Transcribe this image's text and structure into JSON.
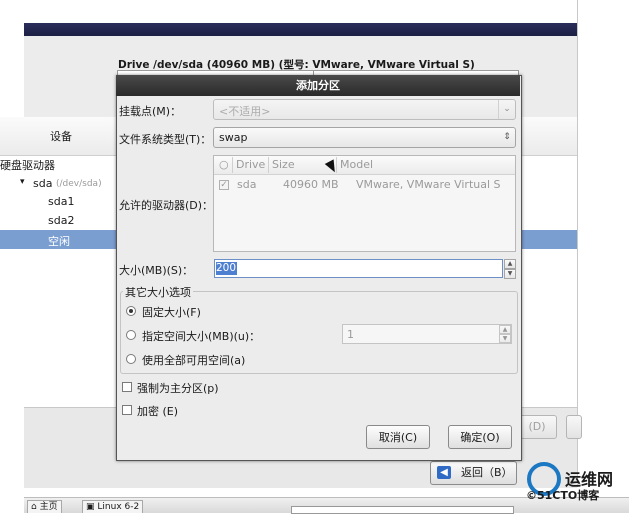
{
  "installer": {
    "drive_title": "Drive /dev/sda (40960 MB) (型号: VMware, VMware Virtual S)",
    "tree_header": "设备",
    "tree_items": [
      "硬盘驱动器",
      "sda",
      "(/dev/sda)",
      "sda1",
      "sda2",
      "空闲"
    ],
    "ghost_button": "(D)",
    "back_button": "返回（B）",
    "back_icon": "arrow-left-icon"
  },
  "dialog": {
    "title": "添加分区",
    "mount_label": "挂载点(M)：",
    "mount_value": "<不适用>",
    "fs_label": "文件系统类型(T)：",
    "fs_value": "swap",
    "drives_label": "允许的驱动器(D)：",
    "drives_columns": [
      "Drive",
      "Size",
      "Model"
    ],
    "drives_row": {
      "drive": "sda",
      "size": "40960 MB",
      "model": "VMware, VMware Virtual S"
    },
    "size_label": "大小(MB)(S)：",
    "size_value": "200",
    "options_title": "其它大小选项",
    "options": [
      "固定大小(F)",
      "指定空间大小(MB)(u)：",
      "使用全部可用空间(a)"
    ],
    "fixed_value": "1",
    "primary_check": "强制为主分区(p)",
    "encrypt_check": "加密 (E)",
    "cancel_button": "取消(C)",
    "ok_button": "确定(O)"
  },
  "taskbar": {
    "items": [
      "主页",
      "Linux 6-2"
    ]
  },
  "watermark": {
    "line1": "运维网",
    "line2": "©51CTO博客"
  },
  "colors": {
    "selection": "#7b9ed1",
    "title_bar": "#2a2a2a",
    "accent": "#4f7fd0"
  }
}
